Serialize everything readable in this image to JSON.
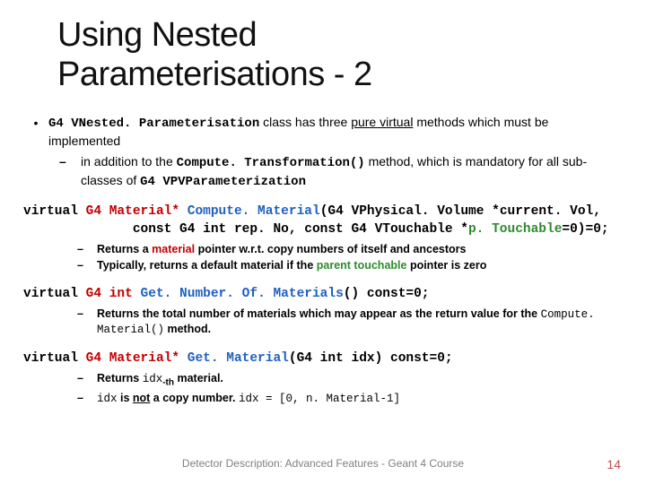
{
  "title_line1": "Using Nested",
  "title_line2": "Parameterisations - 2",
  "intro": {
    "prefix": "G4 VNested. Parameterisation",
    "rest": " class has three ",
    "pure_virtual": "pure virtual",
    "tail": " methods which must be implemented"
  },
  "intro_sub": {
    "prefix": "in addition to the ",
    "method": "Compute. Transformation()",
    "mid": " method, which is mandatory for all sub-classes of ",
    "cls": "G4 VPVParameterization"
  },
  "sig1": {
    "l1a": "virtual ",
    "l1b": "G4 Material*",
    "l1c": " Compute. Material",
    "l1d": "(G4 VPhysical. Volume *current. Vol,",
    "l2a": "              const G4 int rep. No, const G4 VTouchable *",
    "l2b": "p. Touchable",
    "l2c": "=0)=0;"
  },
  "sig1_note1": {
    "a": "Returns a ",
    "b": "material",
    "c": " pointer w.r.t. copy numbers of itself and ancestors"
  },
  "sig1_note2": {
    "a": "Typically, returns a default material if the ",
    "b": "parent touchable",
    "c": " pointer is zero"
  },
  "sig2": {
    "a": "virtual ",
    "b": "G4 int",
    "c": " Get. Number. Of. Materials",
    "d": "() const=0;"
  },
  "sig2_note1": {
    "a": "Returns the total number of materials which may appear as the return value for the ",
    "b": "Compute. Material()",
    "c": " method."
  },
  "sig3": {
    "a": "virtual ",
    "b": "G4 Material*",
    "c": " Get. Material",
    "d": "(G4 int idx) const=0;"
  },
  "sig3_note1": {
    "a": "Returns ",
    "b": "idx",
    "c": "-th",
    "d": " material."
  },
  "sig3_note2": {
    "a": "idx",
    "b": " is ",
    "c": "not",
    "d": " a copy number. ",
    "e": "idx = [0, n. Material-1]"
  },
  "footer": "Detector Description: Advanced Features - Geant 4 Course",
  "pagenum": "14"
}
